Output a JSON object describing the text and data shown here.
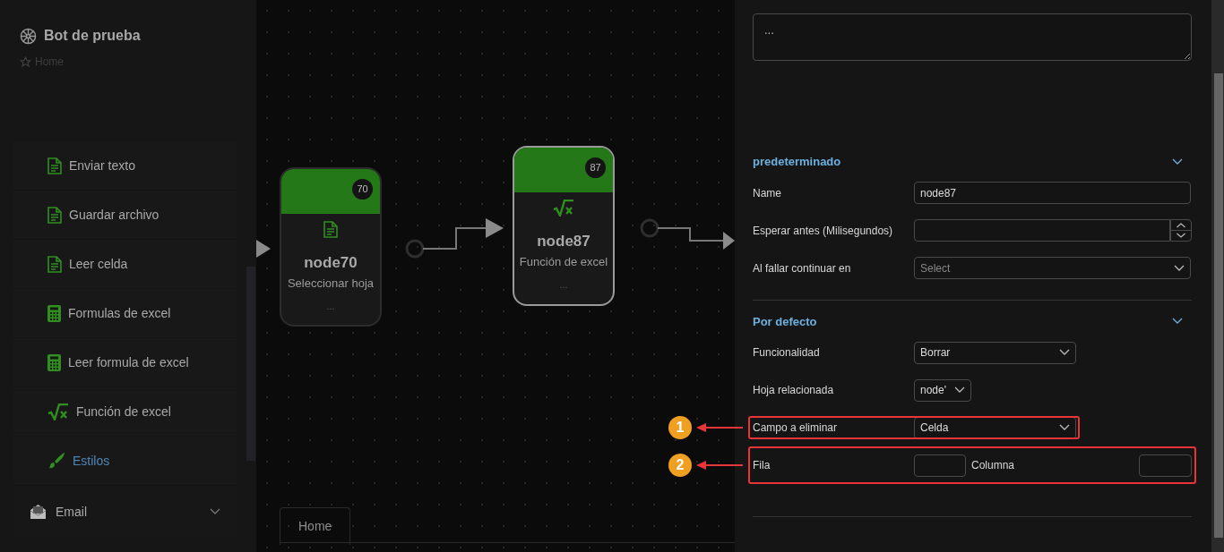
{
  "sidebar": {
    "title": "Bot de prueba",
    "breadcrumb": "Home",
    "items": [
      {
        "label": "Enviar texto",
        "kind": "document",
        "selected": false
      },
      {
        "label": "Guardar archivo",
        "kind": "document",
        "selected": false
      },
      {
        "label": "Leer celda",
        "kind": "document",
        "selected": false
      },
      {
        "label": "Formulas de excel",
        "kind": "calculator",
        "selected": false
      },
      {
        "label": "Leer formula de excel",
        "kind": "calculator",
        "selected": false
      },
      {
        "label": "Función de excel",
        "kind": "sqrt",
        "selected": false
      },
      {
        "label": "Estilos",
        "kind": "brush",
        "selected": true
      }
    ],
    "groups": [
      {
        "label": "Email",
        "expanded": false
      }
    ]
  },
  "canvas": {
    "nodes": [
      {
        "badge": "70",
        "kind": "document",
        "name": "node70",
        "subtitle": "Seleccionar hoja",
        "more": "...",
        "selected": false
      },
      {
        "badge": "87",
        "kind": "sqrt",
        "name": "node87",
        "subtitle": "Función de excel",
        "more": "...",
        "selected": true
      }
    ],
    "tabs": [
      {
        "label": "Home",
        "selected": true
      }
    ]
  },
  "panel": {
    "description": {
      "value": "..."
    },
    "sections": [
      {
        "title": "predeterminado",
        "expanded": true,
        "fields": [
          {
            "kind": "text",
            "label": "Name",
            "value": "node87"
          },
          {
            "kind": "number",
            "label": "Esperar antes (Milisegundos)"
          },
          {
            "kind": "select",
            "label": "Al fallar continuar en",
            "placeholder": "Select"
          }
        ]
      },
      {
        "title": "Por defecto",
        "expanded": true,
        "fields": [
          {
            "kind": "select",
            "label": "Funcionalidad",
            "value": "Borrar"
          },
          {
            "kind": "select",
            "label": "Hoja relacionada",
            "value": "node'"
          },
          {
            "kind": "select",
            "label": "Campo a eliminar",
            "value": "Celda",
            "callout": "1"
          },
          {
            "kind": "pair",
            "label": "Fila",
            "label2": "Columna",
            "callout": "2"
          }
        ]
      }
    ]
  }
}
